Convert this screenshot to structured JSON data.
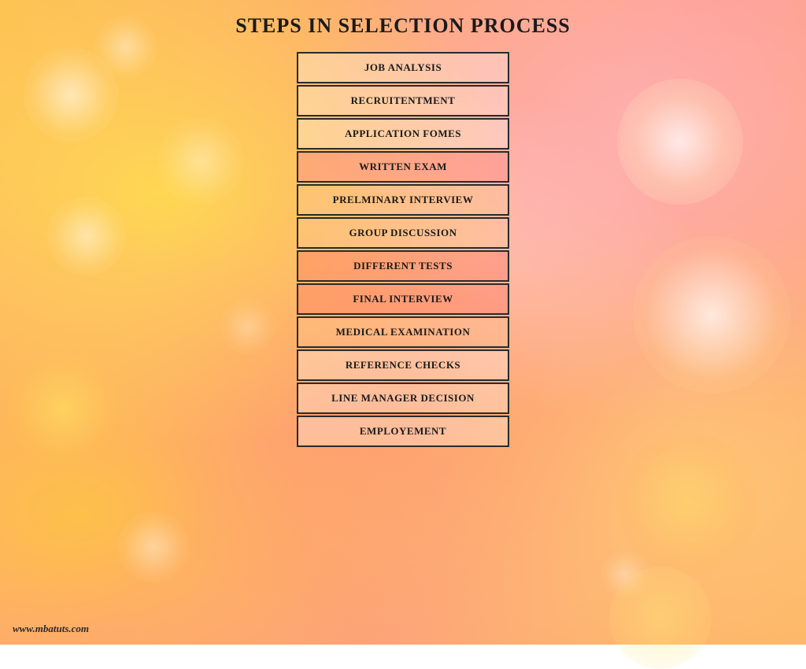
{
  "page": {
    "title": "STEPS IN SELECTION PROCESS",
    "watermark": "www.mbatuts.com"
  },
  "steps": [
    {
      "label": "JOB ANALYSIS",
      "style": "highlight-white"
    },
    {
      "label": "RECRUITENTMENT",
      "style": "highlight-white"
    },
    {
      "label": "APPLICATION FOMES",
      "style": "highlight-white"
    },
    {
      "label": "WRITTEN EXAM",
      "style": "highlight-pink"
    },
    {
      "label": "PRELMINARY INTERVIEW",
      "style": "highlight-light"
    },
    {
      "label": "GROUP DISCUSSION",
      "style": "highlight-light"
    },
    {
      "label": "DIFFERENT TESTS",
      "style": "highlight-salmon"
    },
    {
      "label": "FINAL INTERVIEW",
      "style": "highlight-salmon"
    },
    {
      "label": "MEDICAL  EXAMINATION",
      "style": "highlight-light"
    },
    {
      "label": "REFERENCE CHECKS",
      "style": "highlight-white"
    },
    {
      "label": "LINE MANAGER DECISION",
      "style": "highlight-white"
    },
    {
      "label": "EMPLOYEMENT",
      "style": "highlight-white"
    }
  ]
}
